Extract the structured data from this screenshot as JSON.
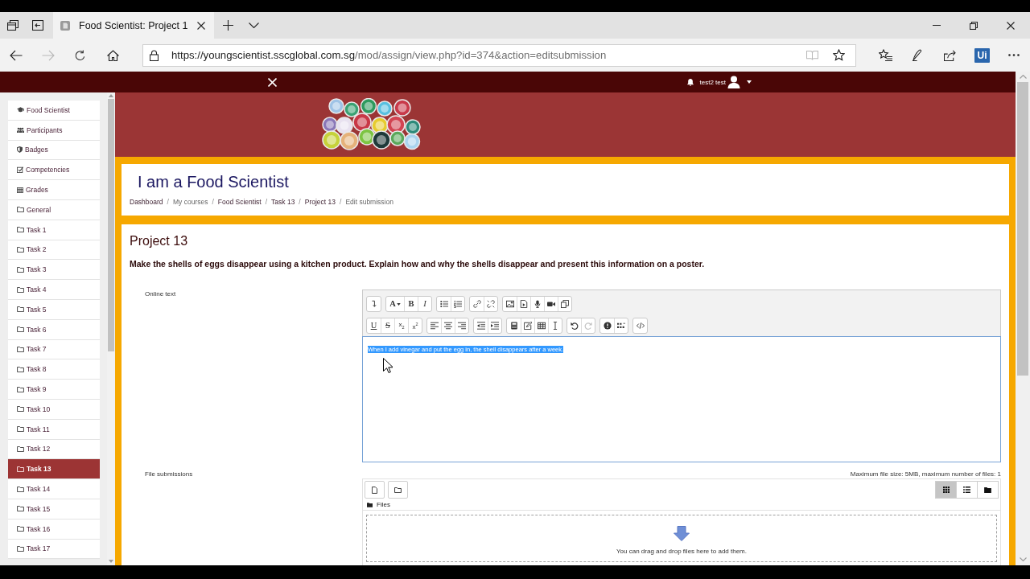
{
  "browser": {
    "tabs": [
      {
        "title": "Food Scientist: Project 1",
        "selected": true
      }
    ],
    "nav_buttons": [
      {
        "kind": "back",
        "disabled": false
      },
      {
        "kind": "forward",
        "disabled": true
      },
      {
        "kind": "refresh",
        "disabled": false
      },
      {
        "kind": "home",
        "disabled": false
      }
    ],
    "url": {
      "host": "https://youngscientist.sscglobal.com.sg",
      "path": "/mod/assign/view.php?id=374&action=editsubmission"
    },
    "address_actions": [
      {
        "kind": "reading-view",
        "disabled": true
      },
      {
        "kind": "favorite",
        "disabled": false
      }
    ],
    "extension_label": "Ui"
  },
  "navbar": {
    "user_name": "test2 test"
  },
  "sidebar": {
    "items": [
      {
        "label": "Food Scientist",
        "kind": "course",
        "selected": false
      },
      {
        "label": "Participants",
        "kind": "participants",
        "selected": false
      },
      {
        "label": "Badges",
        "kind": "badges",
        "selected": false
      },
      {
        "label": "Competencies",
        "kind": "competencies",
        "selected": false
      },
      {
        "label": "Grades",
        "kind": "grades",
        "selected": false
      },
      {
        "label": "General",
        "kind": "section",
        "selected": false
      },
      {
        "label": "Task 1",
        "kind": "section",
        "selected": false
      },
      {
        "label": "Task 2",
        "kind": "section",
        "selected": false
      },
      {
        "label": "Task 3",
        "kind": "section",
        "selected": false
      },
      {
        "label": "Task 4",
        "kind": "section",
        "selected": false
      },
      {
        "label": "Task 5",
        "kind": "section",
        "selected": false
      },
      {
        "label": "Task 6",
        "kind": "section",
        "selected": false
      },
      {
        "label": "Task 7",
        "kind": "section",
        "selected": false
      },
      {
        "label": "Task 8",
        "kind": "section",
        "selected": false
      },
      {
        "label": "Task 9",
        "kind": "section",
        "selected": false
      },
      {
        "label": "Task 10",
        "kind": "section",
        "selected": false
      },
      {
        "label": "Task 11",
        "kind": "section",
        "selected": false
      },
      {
        "label": "Task 12",
        "kind": "section",
        "selected": false
      },
      {
        "label": "Task 13",
        "kind": "section",
        "selected": true
      },
      {
        "label": "Task 14",
        "kind": "section",
        "selected": false
      },
      {
        "label": "Task 15",
        "kind": "section",
        "selected": false
      },
      {
        "label": "Task 16",
        "kind": "section",
        "selected": false
      },
      {
        "label": "Task 17",
        "kind": "section",
        "selected": false
      }
    ]
  },
  "course": {
    "title": "I am a Food Scientist",
    "breadcrumb_separator": "/",
    "breadcrumb": [
      {
        "label": "Dashboard",
        "link": true
      },
      {
        "label": "My courses",
        "link": false
      },
      {
        "label": "Food Scientist",
        "link": true
      },
      {
        "label": "Task 13",
        "link": true
      },
      {
        "label": "Project 13",
        "link": true
      },
      {
        "label": "Edit submission",
        "link": false
      }
    ]
  },
  "assignment": {
    "title": "Project 13",
    "description": "Make the shells of eggs disappear using a kitchen product. Explain how and why the shells disappear and present this information on a poster."
  },
  "online_text": {
    "label": "Online text",
    "toolbar": [
      [
        [
          {
            "kind": "collapse",
            "disabled": false
          }
        ],
        [
          {
            "kind": "font-color",
            "glyph": "A",
            "disabled": false
          },
          {
            "kind": "bold",
            "glyph": "B",
            "disabled": false
          },
          {
            "kind": "italic",
            "glyph": "I",
            "disabled": false
          }
        ],
        [
          {
            "kind": "bullet-list",
            "disabled": false
          },
          {
            "kind": "numbered-list",
            "disabled": false
          }
        ],
        [
          {
            "kind": "link",
            "disabled": false
          },
          {
            "kind": "unlink",
            "disabled": false
          }
        ],
        [
          {
            "kind": "image",
            "disabled": false
          },
          {
            "kind": "media",
            "disabled": false
          },
          {
            "kind": "record-audio",
            "disabled": false
          },
          {
            "kind": "record-video",
            "disabled": false
          },
          {
            "kind": "manage-files",
            "disabled": false
          }
        ]
      ],
      [
        [
          {
            "kind": "underline",
            "glyph": "U",
            "disabled": false
          },
          {
            "kind": "strikethrough",
            "glyph": "S",
            "disabled": false
          },
          {
            "kind": "subscript",
            "glyph": "x$_{2}$",
            "disabled": false
          },
          {
            "kind": "superscript",
            "glyph": "x$^{2}$",
            "disabled": false
          }
        ],
        [
          {
            "kind": "align-left",
            "disabled": false
          },
          {
            "kind": "align-center",
            "disabled": false
          },
          {
            "kind": "align-right",
            "disabled": false
          }
        ],
        [
          {
            "kind": "outdent",
            "disabled": false
          },
          {
            "kind": "indent",
            "disabled": false
          }
        ],
        [
          {
            "kind": "equation",
            "disabled": false
          },
          {
            "kind": "edit",
            "disabled": false
          },
          {
            "kind": "table",
            "disabled": false
          },
          {
            "kind": "clear-formatting",
            "disabled": false
          }
        ],
        [
          {
            "kind": "undo",
            "disabled": false
          },
          {
            "kind": "redo",
            "disabled": true
          }
        ],
        [
          {
            "kind": "accessibility",
            "disabled": false
          },
          {
            "kind": "screenreader",
            "disabled": false
          }
        ],
        [
          {
            "kind": "html",
            "disabled": false
          }
        ]
      ]
    ],
    "content": "When I add vinegar and put the egg in, the shell disappears after a week.",
    "content_selected": true
  },
  "file_submissions": {
    "label": "File submissions",
    "limits": "Maximum file size: 5MB, maximum number of files: 1",
    "views": [
      {
        "kind": "icons",
        "selected": true
      },
      {
        "kind": "list",
        "selected": false
      },
      {
        "kind": "tree",
        "selected": false
      }
    ],
    "folder": "Files",
    "dropzone": "You can drag and drop files here to add them."
  }
}
